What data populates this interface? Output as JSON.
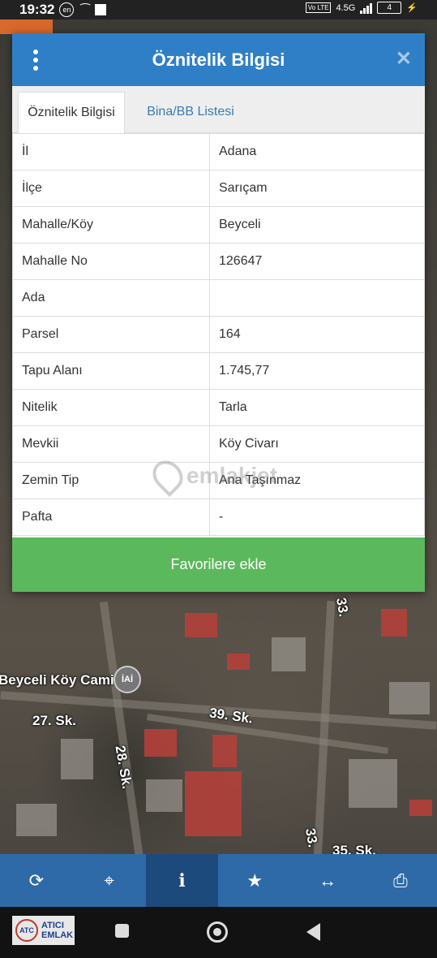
{
  "status_bar": {
    "time": "19:32",
    "language_badge": "en",
    "network": "4.5G",
    "carrier_badge": "Vo LTE",
    "battery": "4"
  },
  "dialog": {
    "title": "Öznitelik Bilgisi",
    "tabs": [
      {
        "label": "Öznitelik Bilgisi",
        "active": true
      },
      {
        "label": "Bina/BB Listesi",
        "active": false
      }
    ],
    "rows": [
      {
        "key": "İl",
        "value": "Adana"
      },
      {
        "key": "İlçe",
        "value": "Sarıçam"
      },
      {
        "key": "Mahalle/Köy",
        "value": "Beyceli"
      },
      {
        "key": "Mahalle No",
        "value": "126647"
      },
      {
        "key": "Ada",
        "value": ""
      },
      {
        "key": "Parsel",
        "value": "164"
      },
      {
        "key": "Tapu Alanı",
        "value": "1.745,77"
      },
      {
        "key": "Nitelik",
        "value": "Tarla"
      },
      {
        "key": "Mevkii",
        "value": "Köy Civarı"
      },
      {
        "key": "Zemin Tip",
        "value": "Ana Taşınmaz"
      },
      {
        "key": "Pafta",
        "value": "-"
      }
    ],
    "favorite_button": "Favorilere ekle",
    "watermark": "emlakjet"
  },
  "map_labels": {
    "mosque": "Beyceli Köy Cami",
    "mosque_icon": "i⃝",
    "street_27": "27. Sk.",
    "street_28": "28. Sk.",
    "street_39": "39. Sk.",
    "street_33a": "33.",
    "street_33b": "33.",
    "street_35": "35. Sk."
  },
  "toolbar": {
    "items": [
      "refresh-icon",
      "locate-icon",
      "info-icon",
      "star-icon",
      "measure-icon",
      "print-icon"
    ],
    "active": "info-icon",
    "color": "#2e6aa8"
  },
  "logo": {
    "line1": "ATICI",
    "line2": "EMLAK",
    "mark": "ATC"
  },
  "colors": {
    "header": "#2f7fc7",
    "favorite": "#5cb85c",
    "tab_link": "#3a79b4"
  }
}
